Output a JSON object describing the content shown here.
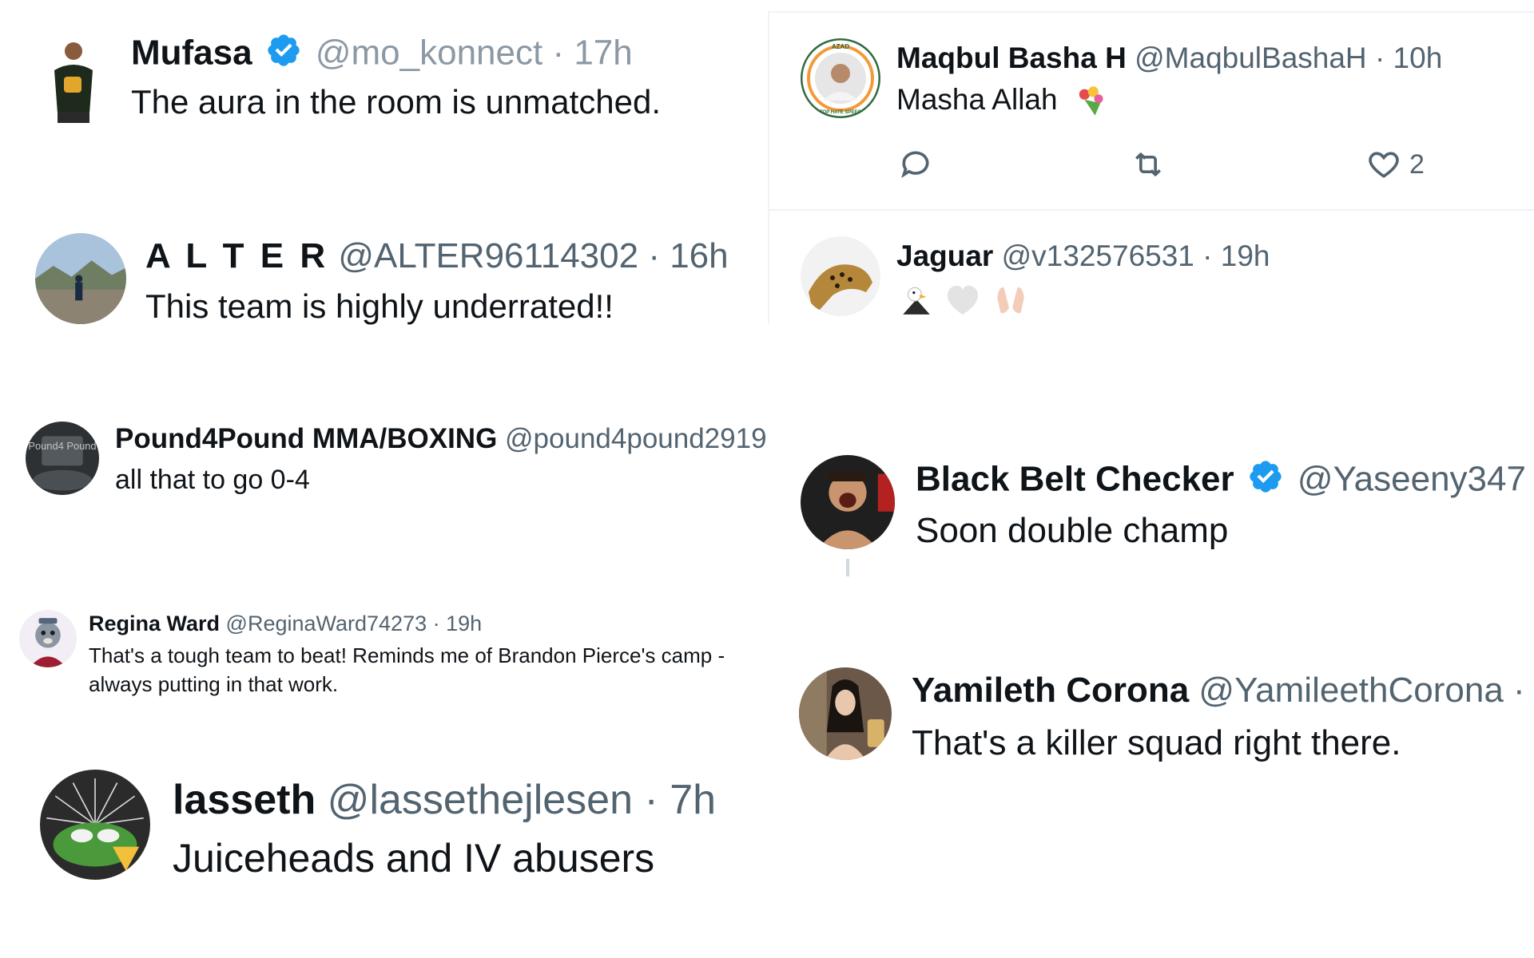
{
  "tweets": [
    {
      "name": "Mufasa",
      "handle": "@mo_konnect",
      "time": "· 17h",
      "text": "The aura in the room is unmatched.",
      "verified": true
    },
    {
      "name": "A L T E R",
      "handle": "@ALTER96114302",
      "time": "· 16h",
      "text": "This team is highly underrated!!"
    },
    {
      "name": "Pound4Pound MMA/BOXING",
      "handle": "@pound4pound2919",
      "time": "",
      "text": "all that to go 0-4",
      "avatar_text": "Pound4 Pound"
    },
    {
      "name": "Regina Ward",
      "handle": "@ReginaWard74273",
      "time": "· 19h",
      "text_line1": "That's a tough team to beat! Reminds me of Brandon Pierce's camp -",
      "text_line2": "always putting in that work."
    },
    {
      "name": "lasseth",
      "handle": "@lassethejlesen",
      "time": "· 7h",
      "text": "Juiceheads and IV abusers"
    },
    {
      "name": "Maqbul Basha H",
      "handle": "@MaqbulBashaH",
      "time": "· 10h",
      "text": "Masha Allah",
      "text_emoji": "bouquet",
      "like_count": "2",
      "avatar_text_top": "AZAD",
      "avatar_text_bottom": "STOP HATE SPEECH"
    },
    {
      "name": "Jaguar",
      "handle": "@v132576531",
      "time": "· 19h",
      "emojis": [
        "eagle",
        "white-heart",
        "palms-up-together"
      ]
    },
    {
      "name": "Black Belt Checker",
      "handle": "@Yaseeny347",
      "time": "",
      "text": "Soon double champ",
      "verified": true
    },
    {
      "name": "Yamileth Corona",
      "handle": "@YamileethCorona",
      "time": "·",
      "text": "That's a killer squad right there."
    }
  ],
  "colors": {
    "verified": "#1d9bf0",
    "meta": "#536471",
    "text": "#0f1419",
    "divider": "#eff3f4"
  }
}
